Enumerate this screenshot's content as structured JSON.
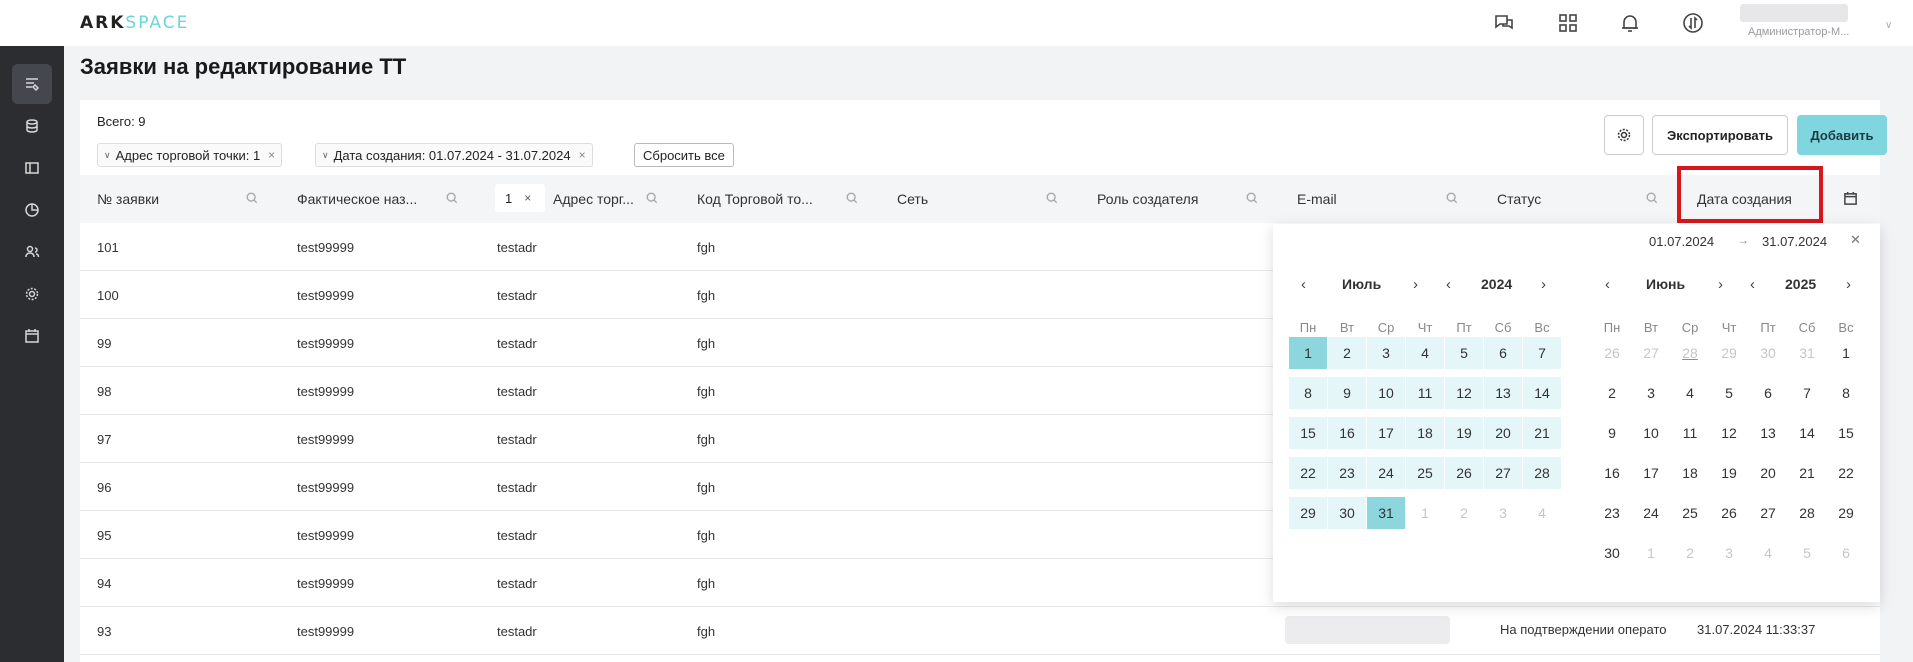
{
  "app": {
    "logo_part1": "ARK",
    "logo_part2": "SPACE",
    "user_role": "Администратор-М..."
  },
  "page": {
    "title": "Заявки на редактирование ТТ",
    "total": "Всего: 9"
  },
  "filters": {
    "chip1": "Адрес торговой точки: 1",
    "chip2": "Дата создания: 01.07.2024 - 31.07.2024",
    "reset": "Сбросить все",
    "numfilter_value": "1"
  },
  "toolbar": {
    "export_label": "Экспортировать",
    "add_label": "Добавить"
  },
  "columns": [
    "№ заявки",
    "Фактическое наз...",
    "Адрес торг...",
    "Код Торговой то...",
    "Сеть",
    "Роль создателя",
    "E-mail",
    "Статус",
    "Дата создания"
  ],
  "rows": [
    {
      "id": "101",
      "name": "test99999",
      "addr": "testadr",
      "code": "fgh"
    },
    {
      "id": "100",
      "name": "test99999",
      "addr": "testadr",
      "code": "fgh"
    },
    {
      "id": "99",
      "name": "test99999",
      "addr": "testadr",
      "code": "fgh"
    },
    {
      "id": "98",
      "name": "test99999",
      "addr": "testadr",
      "code": "fgh"
    },
    {
      "id": "97",
      "name": "test99999",
      "addr": "testadr",
      "code": "fgh"
    },
    {
      "id": "96",
      "name": "test99999",
      "addr": "testadr",
      "code": "fgh"
    },
    {
      "id": "95",
      "name": "test99999",
      "addr": "testadr",
      "code": "fgh"
    },
    {
      "id": "94",
      "name": "test99999",
      "addr": "testadr",
      "code": "fgh"
    },
    {
      "id": "93",
      "name": "test99999",
      "addr": "testadr",
      "code": "fgh",
      "status": "На подтверждении операто",
      "date": "31.07.2024 11:33:37"
    }
  ],
  "datepicker": {
    "range_start": "01.07.2024",
    "range_end": "31.07.2024",
    "left": {
      "month": "Июль",
      "year": "2024"
    },
    "right": {
      "month": "Июнь",
      "year": "2025"
    },
    "weekdays": [
      "Пн",
      "Вт",
      "Ср",
      "Чт",
      "Пт",
      "Сб",
      "Вс"
    ],
    "left_days": [
      "1",
      "2",
      "3",
      "4",
      "5",
      "6",
      "7",
      "8",
      "9",
      "10",
      "11",
      "12",
      "13",
      "14",
      "15",
      "16",
      "17",
      "18",
      "19",
      "20",
      "21",
      "22",
      "23",
      "24",
      "25",
      "26",
      "27",
      "28",
      "29",
      "30",
      "31",
      "1",
      "2",
      "3",
      "4"
    ],
    "right_days": [
      "26",
      "27",
      "28",
      "29",
      "30",
      "31",
      "1",
      "2",
      "3",
      "4",
      "5",
      "6",
      "7",
      "8",
      "9",
      "10",
      "11",
      "12",
      "13",
      "14",
      "15",
      "16",
      "17",
      "18",
      "19",
      "20",
      "21",
      "22",
      "23",
      "24",
      "25",
      "26",
      "27",
      "28",
      "29",
      "30",
      "1",
      "2",
      "3",
      "4",
      "5",
      "6"
    ]
  },
  "colors": {
    "accent": "#7fd6de",
    "highlight": "#d8171c",
    "sidebar": "#2b2d31"
  }
}
